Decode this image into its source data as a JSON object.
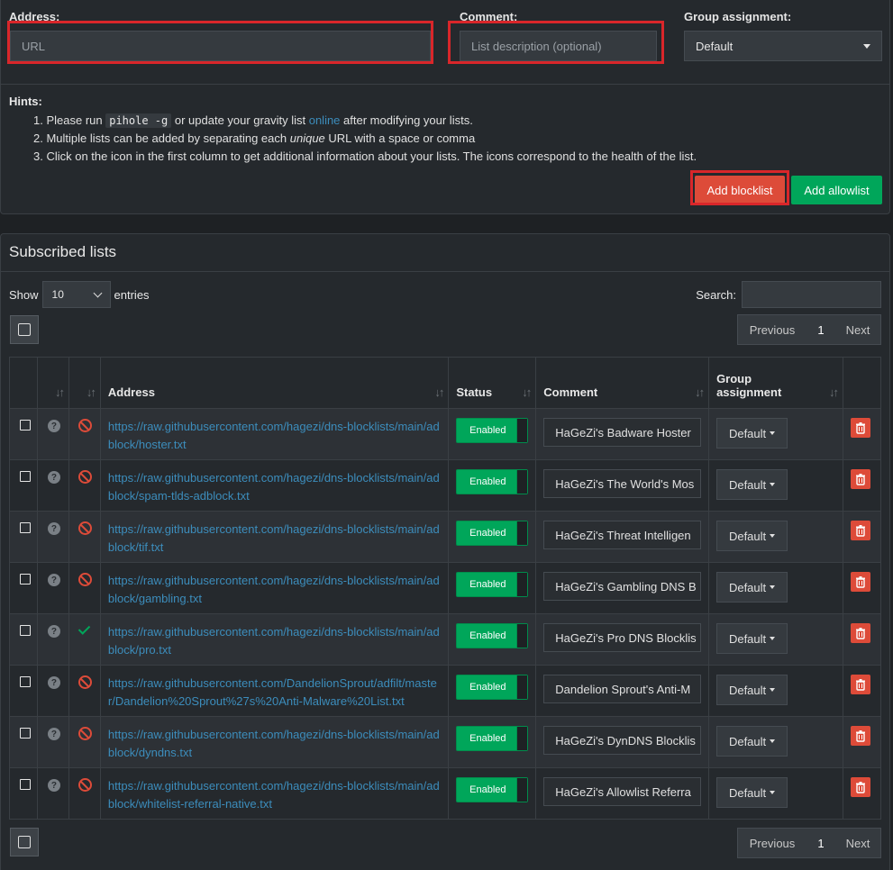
{
  "form": {
    "address_label": "Address:",
    "address_placeholder": "URL",
    "comment_label": "Comment:",
    "comment_placeholder": "List description (optional)",
    "group_label": "Group assignment:",
    "group_value": "Default"
  },
  "hints": {
    "title": "Hints:",
    "h1_pre": "1. Please run ",
    "h1_code": "pihole -g",
    "h1_mid": " or update your gravity list ",
    "h1_link": "online",
    "h1_post": " after modifying your lists.",
    "h2_pre": "2. Multiple lists can be added by separating each ",
    "h2_em": "unique",
    "h2_post": " URL with a space or comma",
    "h3": "3. Click on the icon in the first column to get additional information about your lists. The icons correspond to the health of the list."
  },
  "buttons": {
    "add_blocklist": "Add blocklist",
    "add_allowlist": "Add allowlist"
  },
  "list": {
    "title": "Subscribed lists",
    "show": "Show",
    "page_length": "10",
    "entries": "entries",
    "search": "Search:",
    "previous": "Previous",
    "page": "1",
    "next": "Next"
  },
  "table": {
    "headers": {
      "address": "Address",
      "status": "Status",
      "comment": "Comment",
      "group": "Group assignment"
    },
    "rows": [
      {
        "address": "https://raw.githubusercontent.com/hagezi/dns-blocklists/main/adblock/hoster.txt",
        "health": "ban",
        "status": "Enabled",
        "comment": "HaGeZi's Badware Hoster",
        "group": "Default"
      },
      {
        "address": "https://raw.githubusercontent.com/hagezi/dns-blocklists/main/adblock/spam-tlds-adblock.txt",
        "health": "ban",
        "status": "Enabled",
        "comment": "HaGeZi's The World's Mos",
        "group": "Default"
      },
      {
        "address": "https://raw.githubusercontent.com/hagezi/dns-blocklists/main/adblock/tif.txt",
        "health": "ban",
        "status": "Enabled",
        "comment": "HaGeZi's Threat Intelligen",
        "group": "Default"
      },
      {
        "address": "https://raw.githubusercontent.com/hagezi/dns-blocklists/main/adblock/gambling.txt",
        "health": "ban",
        "status": "Enabled",
        "comment": "HaGeZi's Gambling DNS B",
        "group": "Default"
      },
      {
        "address": "https://raw.githubusercontent.com/hagezi/dns-blocklists/main/adblock/pro.txt",
        "health": "check",
        "status": "Enabled",
        "comment": "HaGeZi's Pro DNS Blocklis",
        "group": "Default"
      },
      {
        "address": "https://raw.githubusercontent.com/DandelionSprout/adfilt/master/Dandelion%20Sprout%27s%20Anti-Malware%20List.txt",
        "health": "ban",
        "status": "Enabled",
        "comment": "Dandelion Sprout's Anti-M",
        "group": "Default"
      },
      {
        "address": "https://raw.githubusercontent.com/hagezi/dns-blocklists/main/adblock/dyndns.txt",
        "health": "ban",
        "status": "Enabled",
        "comment": "HaGeZi's DynDNS Blocklis",
        "group": "Default"
      },
      {
        "address": "https://raw.githubusercontent.com/hagezi/dns-blocklists/main/adblock/whitelist-referral-native.txt",
        "health": "ban",
        "status": "Enabled",
        "comment": "HaGeZi's Allowlist Referra",
        "group": "Default"
      }
    ]
  },
  "colors": {
    "accent_red": "#dd4b39",
    "accent_green": "#00a65a",
    "link": "#3c8dbc",
    "highlight": "#d9262a"
  }
}
